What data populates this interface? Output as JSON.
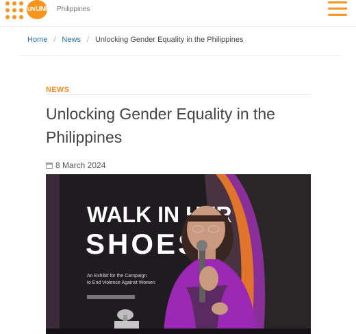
{
  "header": {
    "logo_text": "UNFPA",
    "logo_un": "UN",
    "country": "Philippines",
    "menu_icon": "hamburger-menu-icon",
    "brand_color": "#f7941d"
  },
  "breadcrumb": {
    "items": [
      "Home",
      "News",
      "Unlocking Gender Equality in the Philippines"
    ],
    "separator": "/"
  },
  "article": {
    "category": "NEWS",
    "title": "Unlocking Gender Equality in the Philippines",
    "date": "8 March 2024",
    "date_icon": "calendar-icon",
    "hero_image_text": {
      "headline_line1": "WALK IN HER",
      "headline_line2": "SHOES",
      "subtitle_lines": [
        "An Exhibit for the Campaign",
        "to End Violence Against Women"
      ]
    }
  }
}
